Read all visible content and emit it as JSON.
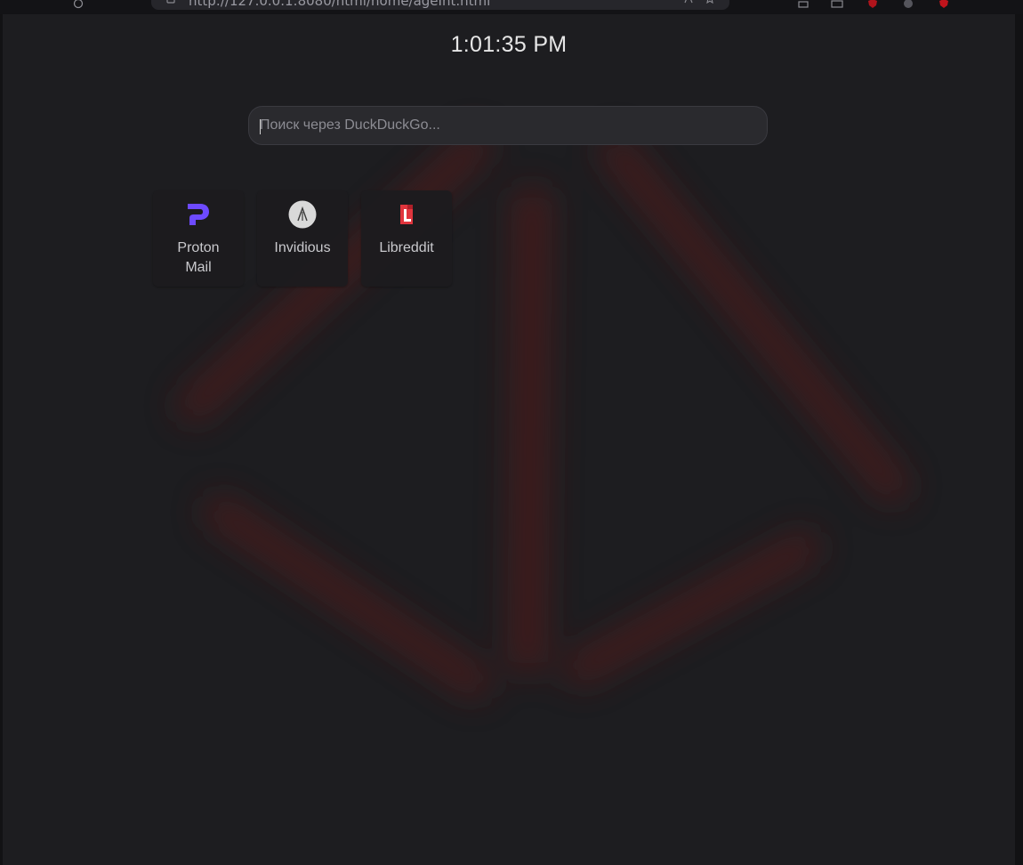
{
  "browser": {
    "url": "http://127.0.0.1:8080/html/home/ageInt.html"
  },
  "clock": {
    "time": "1:01:35 PM"
  },
  "search": {
    "placeholder": "Поиск через DuckDuckGo...",
    "value": ""
  },
  "shortcuts": [
    {
      "label": "Proton Mail",
      "icon": "proton-mail-logo-icon"
    },
    {
      "label": "Invidious",
      "icon": "invidious-logo-icon"
    },
    {
      "label": "Libreddit",
      "icon": "libreddit-logo-icon"
    }
  ],
  "colors": {
    "background": "#1d1d20",
    "accent_glow": "#6a1c1f",
    "proton_purple": "#6d4aff",
    "libreddit_red": "#e0353d"
  }
}
